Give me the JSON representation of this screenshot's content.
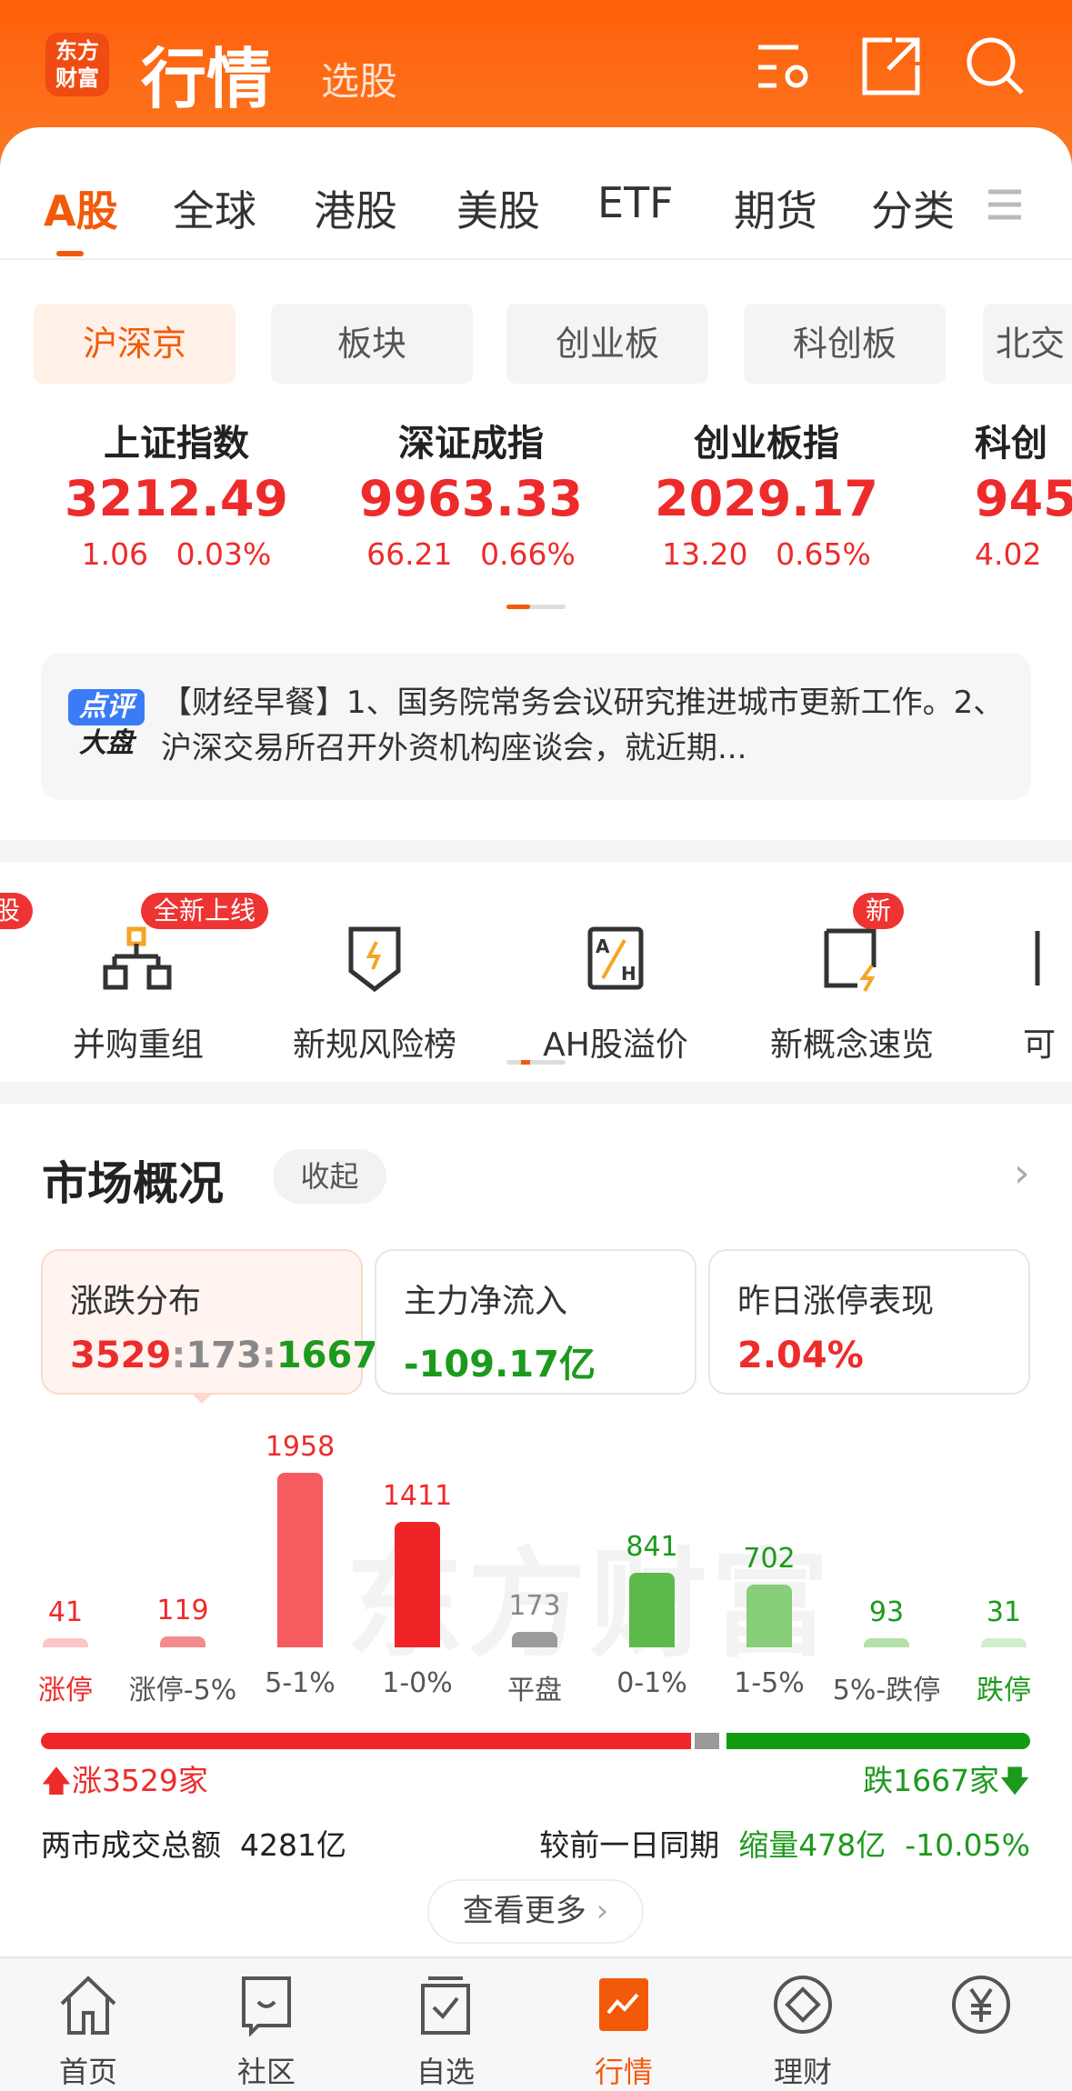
{
  "header": {
    "logo": "东方财富",
    "title": "行情",
    "subtitle": "选股"
  },
  "tabs": [
    "A股",
    "全球",
    "港股",
    "美股",
    "ETF",
    "期货",
    "分类"
  ],
  "subtabs": [
    "沪深京",
    "板块",
    "创业板",
    "科创板",
    "北交"
  ],
  "indices": [
    {
      "name": "上证指数",
      "value": "3212.49",
      "change": "1.06",
      "pct": "0.03%"
    },
    {
      "name": "深证成指",
      "value": "9963.33",
      "change": "66.21",
      "pct": "0.66%"
    },
    {
      "name": "创业板指",
      "value": "2029.17",
      "change": "13.20",
      "pct": "0.65%"
    },
    {
      "name": "科创",
      "value": "945",
      "change": "4.02",
      "pct": ""
    }
  ],
  "news": {
    "badge_top": "点评",
    "badge_bottom": "大盘",
    "text": "【财经早餐】1、国务院常务会议研究推进城市更新工作。2、沪深交易所召开外资机构座谈会，就近期..."
  },
  "tools": [
    {
      "label": "并购重组",
      "badge": "全新上线"
    },
    {
      "label": "新规风险榜"
    },
    {
      "label": "AH股溢价"
    },
    {
      "label": "新概念速览",
      "badge": "新"
    },
    {
      "label": "可"
    }
  ],
  "tools_partial_badge": "股",
  "market": {
    "title": "市场概况",
    "collapse": "收起",
    "cards": [
      {
        "title": "涨跌分布",
        "up": "3529",
        "flat": "173",
        "down": "1667"
      },
      {
        "title": "主力净流入",
        "value": "-109.17亿"
      },
      {
        "title": "昨日涨停表现",
        "value": "2.04%"
      }
    ],
    "watermark": "东方财富",
    "up_label": "涨3529家",
    "down_label": "跌1667家",
    "turnover_label": "两市成交总额",
    "turnover": "4281亿",
    "compare_label": "较前一日同期",
    "compare_change": "缩量478亿",
    "compare_pct": "-10.05%",
    "more": "查看更多"
  },
  "chart_data": {
    "type": "bar",
    "categories": [
      "涨停",
      "涨停-5%",
      "5-1%",
      "1-0%",
      "平盘",
      "0-1%",
      "1-5%",
      "5%-跌停",
      "跌停"
    ],
    "values": [
      41,
      119,
      1958,
      1411,
      173,
      841,
      702,
      93,
      31
    ],
    "colors": [
      "#fbc6c6",
      "#f48c8e",
      "#f55b5f",
      "#f02326",
      "#9b9b9b",
      "#5cba4a",
      "#86cf78",
      "#b3e0a9",
      "#d3edcb"
    ],
    "ratio": {
      "up": 3529,
      "flat": 173,
      "down": 1667
    }
  },
  "colors": {
    "accent": "#f25a0a",
    "up": "#ee2b2b",
    "down": "#1c9a1c"
  },
  "nav": [
    "首页",
    "社区",
    "自选",
    "行情",
    "理财",
    ""
  ]
}
